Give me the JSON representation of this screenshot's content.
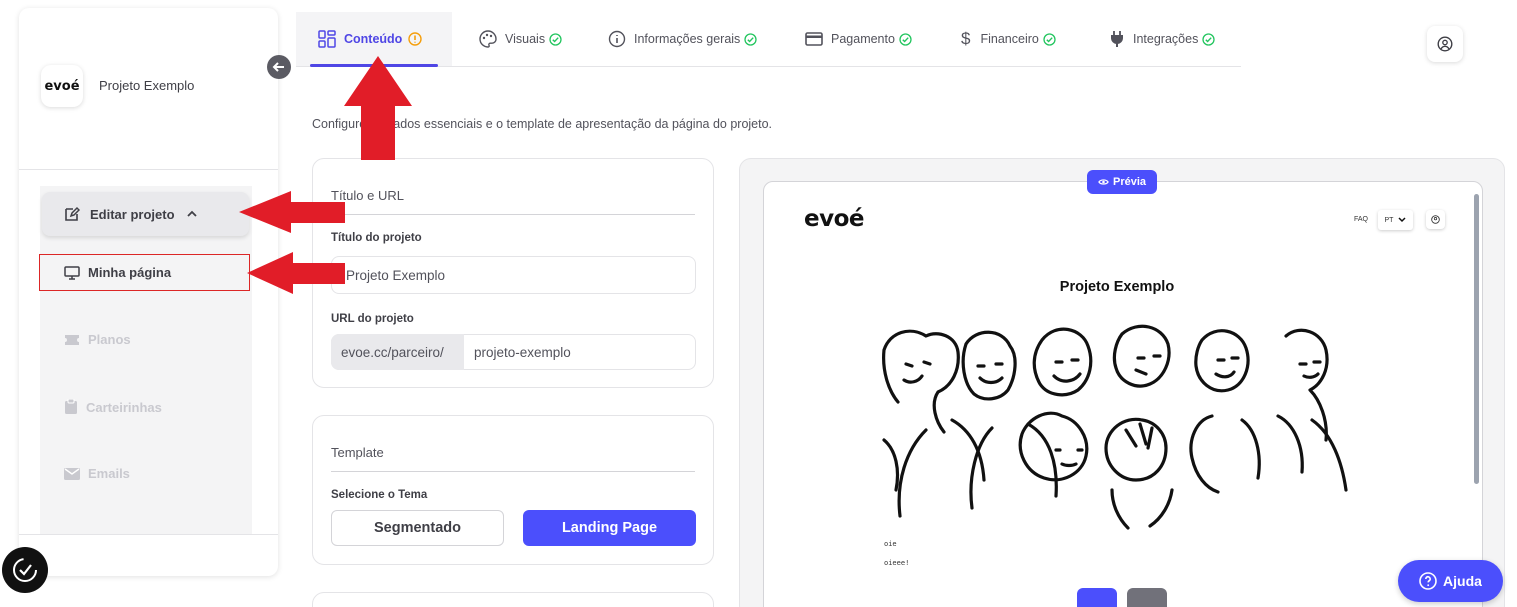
{
  "sidebar": {
    "logo_text": "evoé",
    "project_name": "Projeto Exemplo",
    "edit_project_label": "Editar projeto",
    "items": [
      {
        "label": "Minha página",
        "icon": "monitor-icon",
        "active": true
      },
      {
        "label": "Planos",
        "icon": "ticket-icon",
        "active": false
      },
      {
        "label": "Carteirinhas",
        "icon": "badge-icon",
        "active": false
      },
      {
        "label": "Emails",
        "icon": "mail-icon",
        "active": false
      }
    ]
  },
  "tabs": [
    {
      "label": "Conteúdo",
      "status": "warning",
      "active": true
    },
    {
      "label": "Visuais",
      "status": "ok"
    },
    {
      "label": "Informações gerais",
      "status": "ok"
    },
    {
      "label": "Pagamento",
      "status": "ok"
    },
    {
      "label": "Financeiro",
      "status": "ok"
    },
    {
      "label": "Integrações",
      "status": "ok"
    }
  ],
  "description": "Configure os dados essenciais e o template de apresentação da página do projeto.",
  "title_card": {
    "heading": "Título e URL",
    "title_label": "Título do projeto",
    "title_value": "Projeto Exemplo",
    "url_label": "URL do projeto",
    "url_prefix": "evoe.cc/parceiro/",
    "url_value": "projeto-exemplo"
  },
  "template_card": {
    "heading": "Template",
    "theme_label": "Selecione o Tema",
    "option_segmented": "Segmentado",
    "option_landing": "Landing Page",
    "selected": "Landing Page"
  },
  "preview": {
    "badge": "Prévia",
    "logo": "evoé",
    "faq": "FAQ",
    "lang": "PT",
    "title": "Projeto Exemplo",
    "text_1": "oie",
    "text_2": "oieee!"
  },
  "help_label": "Ajuda",
  "colors": {
    "accent": "#4b4ffc",
    "tab_active": "#4f46e5",
    "ok": "#22c55e",
    "warning": "#f59e0b",
    "annotation": "#e11d28"
  }
}
